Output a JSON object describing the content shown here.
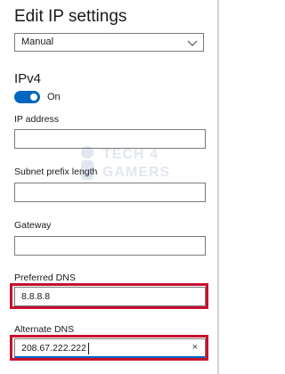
{
  "header": {
    "title": "Edit IP settings"
  },
  "mode_select": {
    "value": "Manual",
    "icon": "chevron-down-icon"
  },
  "ipv4": {
    "section_title": "IPv4",
    "toggle": {
      "state": "On",
      "enabled": true,
      "color": "#0067c0"
    },
    "fields": {
      "ip_address": {
        "label": "IP address",
        "value": ""
      },
      "subnet_prefix_length": {
        "label": "Subnet prefix length",
        "value": ""
      },
      "gateway": {
        "label": "Gateway",
        "value": ""
      },
      "preferred_dns": {
        "label": "Preferred DNS",
        "value": "8.8.8.8"
      },
      "alternate_dns": {
        "label": "Alternate DNS",
        "value": "208.67.222.222",
        "clear_icon": "×"
      }
    }
  },
  "watermark": {
    "line1": "TECH",
    "line2": "GAMERS",
    "line3": "4"
  },
  "colors": {
    "highlight": "#c8102e",
    "accent": "#0067c0"
  }
}
